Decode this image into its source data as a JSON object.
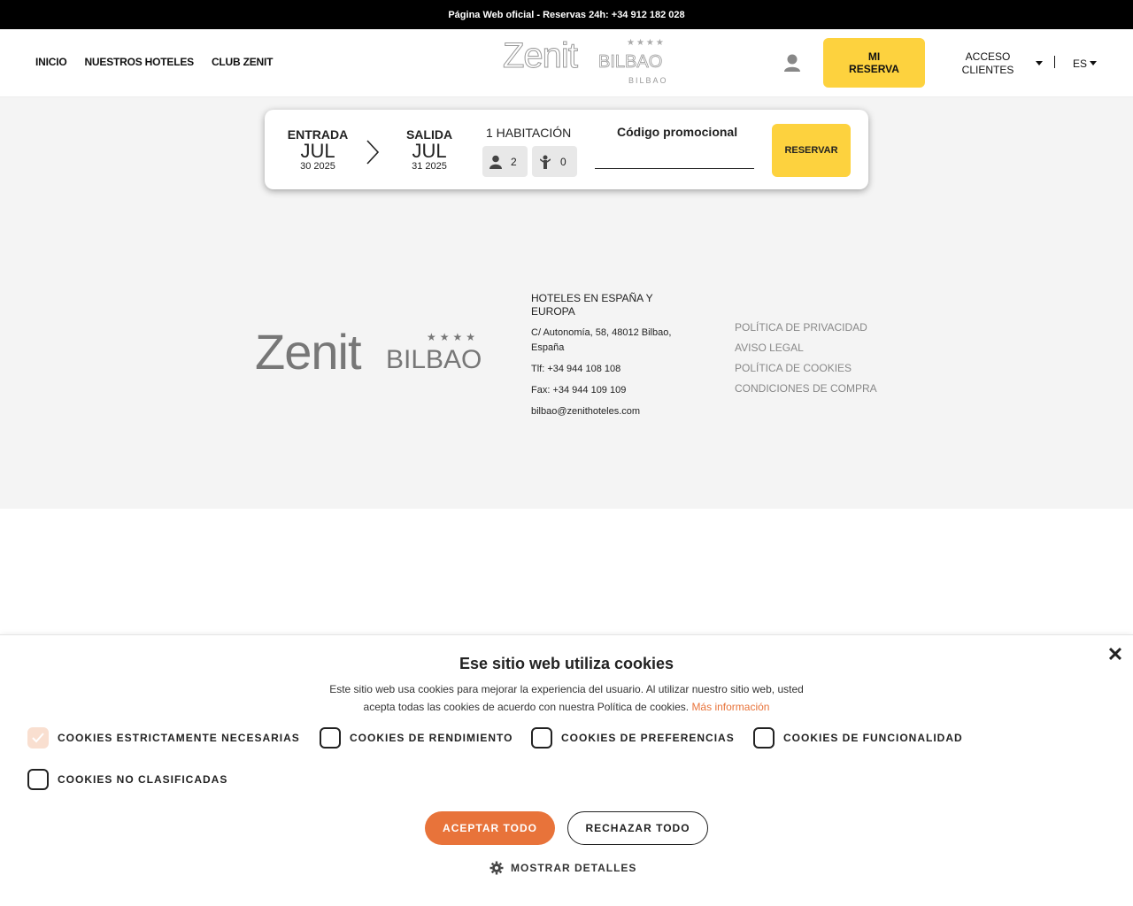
{
  "topbar": {
    "text": "Página Web oficial - Reservas 24h: +34 912 182 028"
  },
  "nav": {
    "items": [
      "INICIO",
      "NUESTROS HOTELES",
      "CLUB ZENIT"
    ]
  },
  "logo": {
    "brand": "Zenit",
    "city": "BILBAO",
    "stars": "★★★★",
    "sub": "BILBAO"
  },
  "header": {
    "mi_reserva_line1": "MI",
    "mi_reserva_line2": "RESERVA",
    "acceso_line1": "ACCESO",
    "acceso_line2": "CLIENTES",
    "lang": "ES"
  },
  "booking": {
    "entrada_label": "ENTRADA",
    "entrada_month": "JUL",
    "entrada_dayyear": "30 2025",
    "salida_label": "SALIDA",
    "salida_month": "JUL",
    "salida_dayyear": "31 2025",
    "habitacion": "1 HABITACIÓN",
    "adults": "2",
    "children": "0",
    "promo_label": "Código promocional",
    "promo_value": "",
    "reservar": "RESERVAR"
  },
  "footer": {
    "logo_brand": "Zenit",
    "logo_city": "BILBAO",
    "logo_stars": "★★★★",
    "heading": "HOTELES EN ESPAÑA Y EUROPA",
    "address": "C/ Autonomía, 58, 48012 Bilbao, España",
    "tlf": "Tlf: +34 944 108 108",
    "fax": "Fax: +34 944 109 109",
    "email": "bilbao@zenithoteles.com",
    "links": [
      "POLÍTICA DE PRIVACIDAD",
      "AVISO LEGAL",
      "POLÍTICA DE COOKIES",
      "CONDICIONES DE COMPRA"
    ]
  },
  "cookie": {
    "title": "Ese sitio web utiliza cookies",
    "desc_line1": "Este sitio web usa cookies para mejorar la experiencia del usuario. Al utilizar nuestro sitio web, usted",
    "desc_line2": "acepta todas las cookies de acuerdo con nuestra Política de cookies. ",
    "more": "Más información",
    "close": "✕",
    "options": [
      {
        "label": "COOKIES ESTRICTAMENTE NECESARIAS",
        "checked": true
      },
      {
        "label": "COOKIES DE RENDIMIENTO",
        "checked": false
      },
      {
        "label": "COOKIES DE PREFERENCIAS",
        "checked": false
      },
      {
        "label": "COOKIES DE FUNCIONALIDAD",
        "checked": false
      },
      {
        "label": "COOKIES NO CLASIFICADAS",
        "checked": false
      }
    ],
    "accept": "ACEPTAR TODO",
    "reject": "RECHAZAR TODO",
    "details": "MOSTRAR DETALLES"
  },
  "colors": {
    "accent_yellow": "#fdd23e",
    "accent_orange": "#e8733a",
    "footer_bg": "#f4f4f4"
  }
}
